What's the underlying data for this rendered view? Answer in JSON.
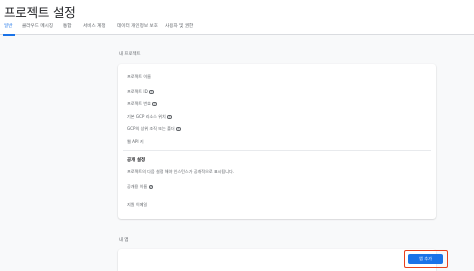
{
  "page": {
    "title": "프로젝트 설정"
  },
  "tabs": [
    {
      "label": "일반"
    },
    {
      "label": "클라우드 메시징"
    },
    {
      "label": "통합"
    },
    {
      "label": "서비스 계정"
    },
    {
      "label": "데이터 개인정보 보호"
    },
    {
      "label": "사용자 및 권한"
    }
  ],
  "project_section": {
    "heading": "내 프로젝트",
    "rows": [
      {
        "label": "프로젝트 이름"
      },
      {
        "label": "프로젝트 ID"
      },
      {
        "label": "프로젝트 번호"
      },
      {
        "label": "기본 GCP 리소스 위치"
      },
      {
        "label": "GCP의 상위 조직 또는 폴더"
      },
      {
        "label": "웹 API 키"
      }
    ],
    "help_icon": "help-circle-icon"
  },
  "public_settings": {
    "heading": "공개 설정",
    "description": "프로젝트의 다음 설정 해야 인스턴스가 공개적으로 표시됩니다.",
    "rows": [
      {
        "label": "공개용 이름"
      },
      {
        "label": "지원 이메일"
      }
    ]
  },
  "apps_section": {
    "heading": "내 앱",
    "add_button_label": "앱 추가"
  },
  "colors": {
    "accent": "#1a73e8",
    "highlight": "#e8401c"
  }
}
